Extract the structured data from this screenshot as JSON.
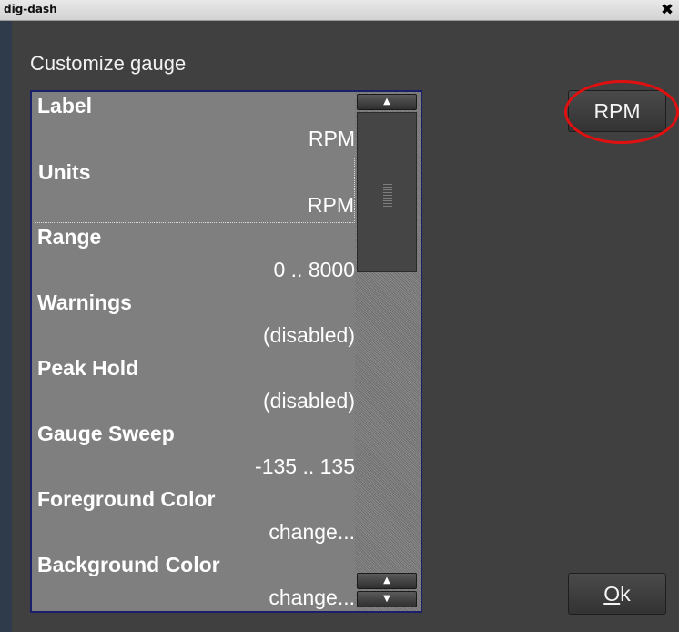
{
  "window": {
    "title": "dig-dash",
    "close_glyph": "✖"
  },
  "dialog": {
    "heading": "Customize gauge"
  },
  "list": {
    "items": [
      {
        "label": "Label",
        "value": "RPM"
      },
      {
        "label": "Units",
        "value": "RPM"
      },
      {
        "label": "Range",
        "value": "0 .. 8000"
      },
      {
        "label": "Warnings",
        "value": "(disabled)"
      },
      {
        "label": "Peak Hold",
        "value": "(disabled)"
      },
      {
        "label": "Gauge Sweep",
        "value": "-135 .. 135"
      },
      {
        "label": "Foreground Color",
        "value": "change..."
      },
      {
        "label": "Background Color",
        "value": "change..."
      }
    ]
  },
  "scroll": {
    "up_glyph": "▲",
    "down_glyph": "▼"
  },
  "buttons": {
    "preview_label": "RPM",
    "ok_label_accel": "O",
    "ok_label_rest": "k"
  },
  "colors": {
    "annotation": "#e01010",
    "list_bg": "#7f7f7f",
    "dialog_bg": "#404040"
  }
}
